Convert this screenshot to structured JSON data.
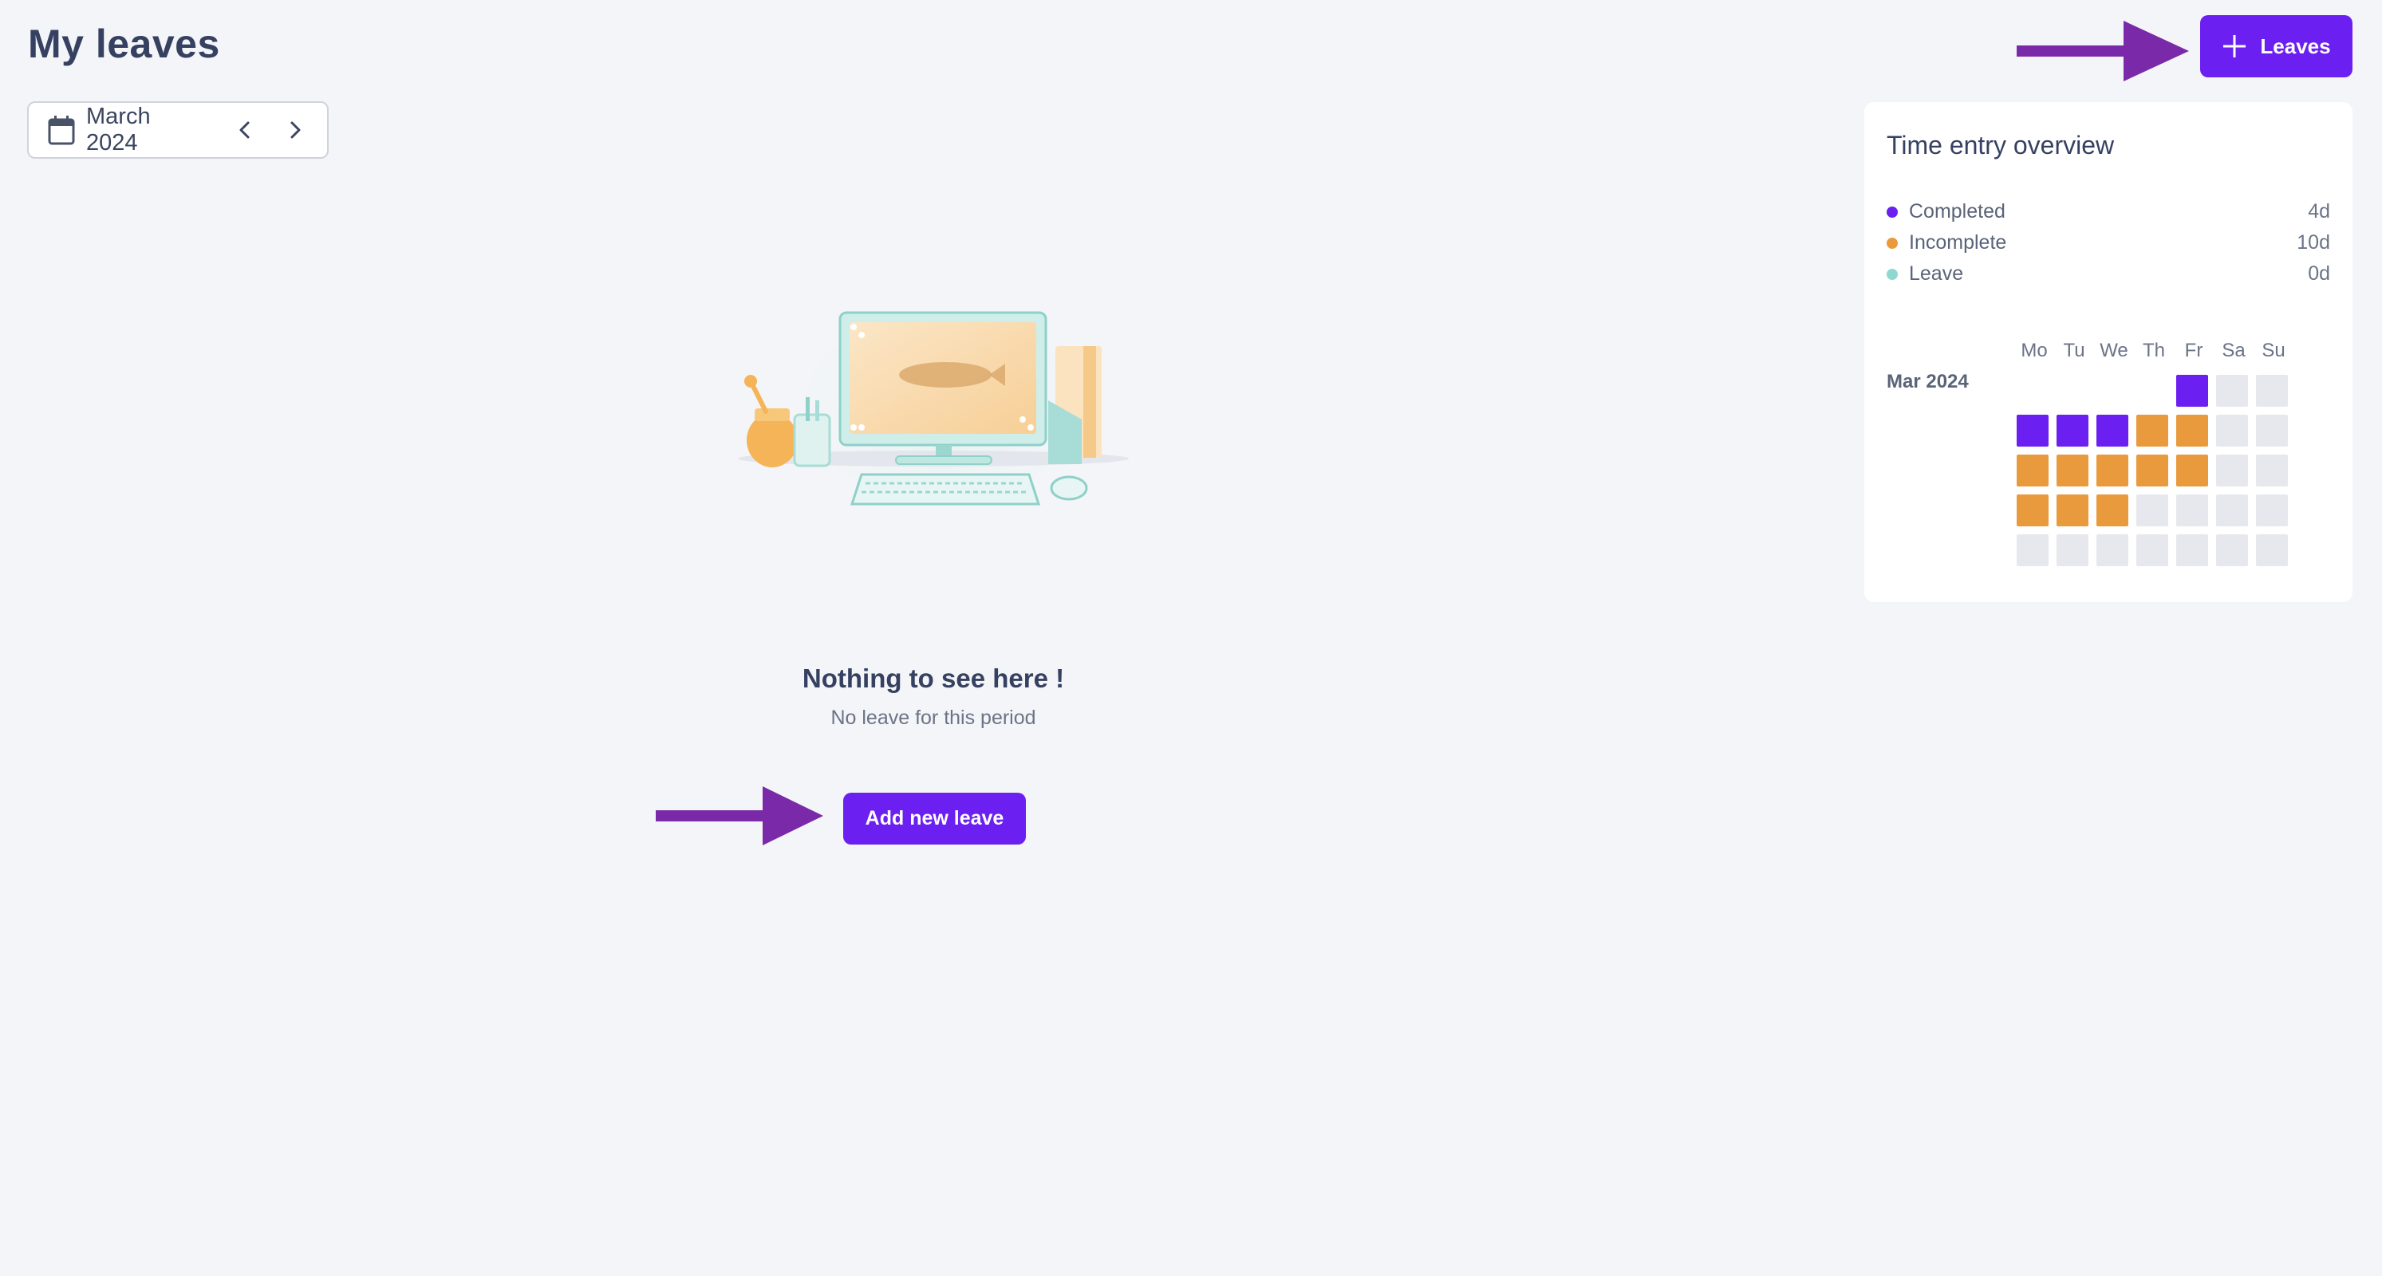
{
  "page": {
    "title": "My leaves"
  },
  "month_picker": {
    "label": "March 2024",
    "icons": {
      "calendar": "calendar-icon",
      "prev": "chevron-left-icon",
      "next": "chevron-right-icon"
    }
  },
  "header": {
    "add_leaves_label": "Leaves",
    "add_icon": "plus-icon"
  },
  "overview": {
    "title": "Time entry overview",
    "legend": [
      {
        "label": "Completed",
        "value": "4d",
        "color": "#6b1ff0"
      },
      {
        "label": "Incomplete",
        "value": "10d",
        "color": "#e99a3d"
      },
      {
        "label": "Leave",
        "value": "0d",
        "color": "#8fd8d2"
      }
    ],
    "calendar": {
      "month_label": "Mar 2024",
      "weekdays": [
        "Mo",
        "Tu",
        "We",
        "Th",
        "Fr",
        "Sa",
        "Su"
      ],
      "weeks": [
        [
          "blank",
          "blank",
          "blank",
          "blank",
          "completed",
          "empty",
          "empty"
        ],
        [
          "completed",
          "completed",
          "completed",
          "incomplete",
          "incomplete",
          "empty",
          "empty"
        ],
        [
          "incomplete",
          "incomplete",
          "incomplete",
          "incomplete",
          "incomplete",
          "empty",
          "empty"
        ],
        [
          "incomplete",
          "incomplete",
          "incomplete",
          "empty",
          "empty",
          "empty",
          "empty"
        ],
        [
          "empty",
          "empty",
          "empty",
          "empty",
          "empty",
          "empty",
          "empty"
        ]
      ]
    }
  },
  "empty_state": {
    "title": "Nothing to see here !",
    "subtitle": "No leave for this period",
    "button_label": "Add new leave"
  },
  "colors": {
    "accent": "#6b1ff0",
    "arrow": "#7a2aa8",
    "incomplete": "#e99a3d",
    "empty_cell": "#e7e8ed",
    "background": "#f4f5f8"
  }
}
